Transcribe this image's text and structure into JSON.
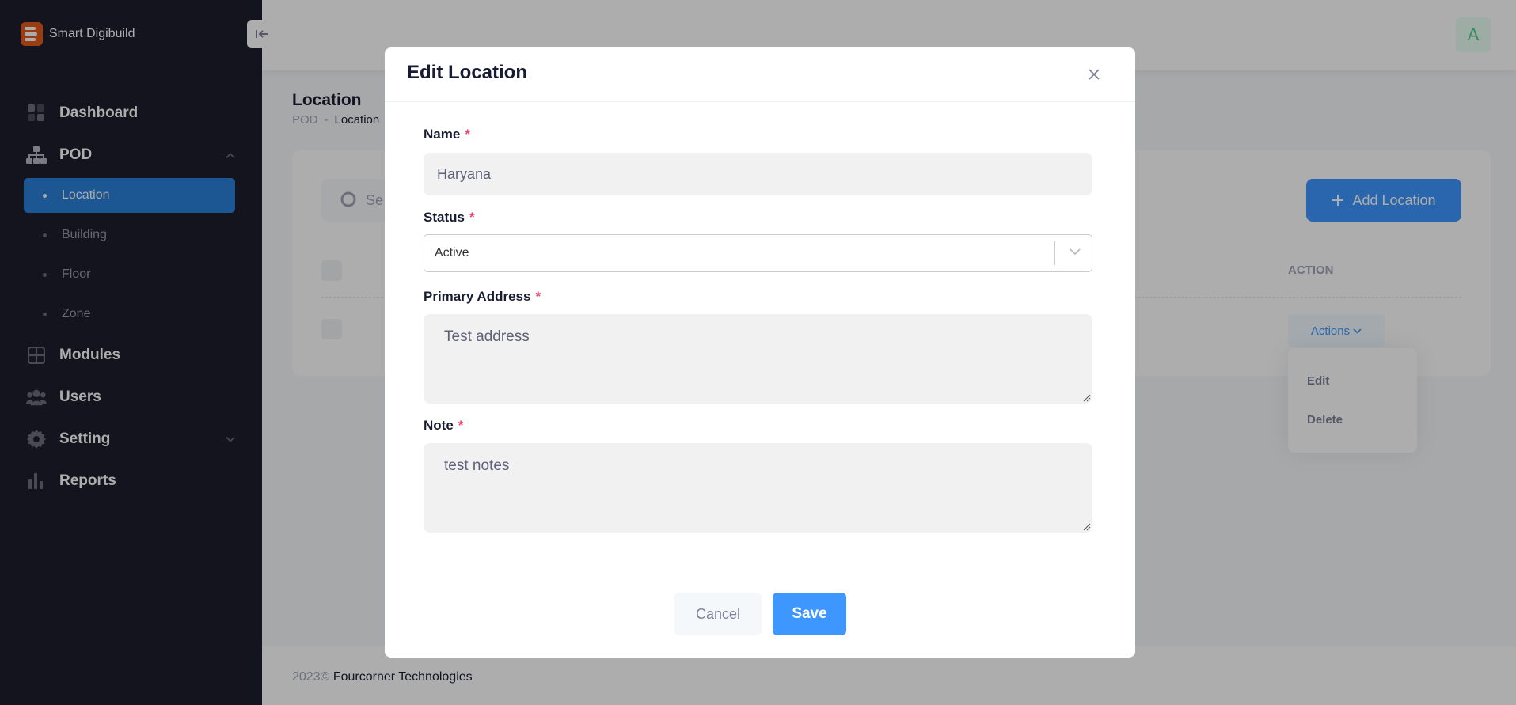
{
  "app": {
    "brand_name": "Smart Digibuild"
  },
  "sidebar": {
    "items": [
      {
        "label": "Dashboard",
        "icon": "dashboard-icon"
      },
      {
        "label": "POD",
        "icon": "sitemap-icon",
        "expanded": true,
        "children": [
          {
            "label": "Location",
            "active": true
          },
          {
            "label": "Building"
          },
          {
            "label": "Floor"
          },
          {
            "label": "Zone"
          }
        ]
      },
      {
        "label": "Modules",
        "icon": "grid-icon"
      },
      {
        "label": "Users",
        "icon": "users-icon"
      },
      {
        "label": "Setting",
        "icon": "gear-icon",
        "expandable": true
      },
      {
        "label": "Reports",
        "icon": "bar-chart-icon"
      }
    ]
  },
  "header": {
    "avatar_letter": "A"
  },
  "page": {
    "title": "Location",
    "breadcrumb": [
      "POD",
      "Location"
    ],
    "breadcrumb_sep": "-",
    "search_placeholder": "Se",
    "add_button": "Add Location",
    "table": {
      "action_header": "ACTION"
    },
    "actions_button": "Actions",
    "actions_menu": [
      "Edit",
      "Delete"
    ]
  },
  "footer": {
    "year": "2023©",
    "company": "Fourcorner Technologies"
  },
  "modal": {
    "title": "Edit Location",
    "fields": {
      "name": {
        "label": "Name",
        "value": "Haryana"
      },
      "status": {
        "label": "Status",
        "value": "Active"
      },
      "primary_address": {
        "label": "Primary Address",
        "value": "Test address"
      },
      "note": {
        "label": "Note",
        "value": "test notes"
      }
    },
    "required_mark": "*",
    "cancel": "Cancel",
    "save": "Save"
  },
  "colors": {
    "sidebar_bg": "#1e1e2d",
    "primary": "#3e97ff",
    "active_item": "#2a7fd9",
    "required": "#f1416c"
  }
}
